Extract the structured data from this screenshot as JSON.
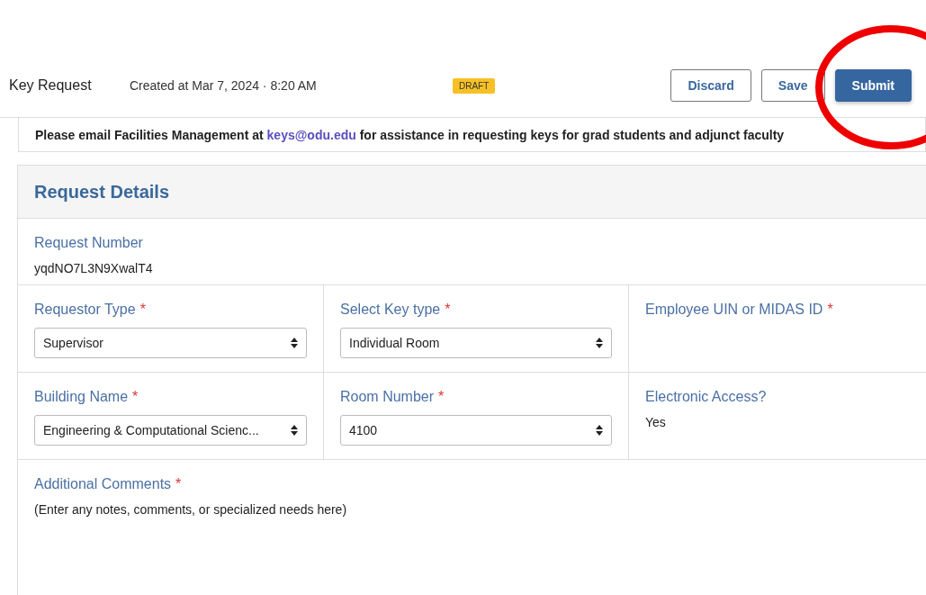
{
  "header": {
    "title": "Key Request",
    "created": "Created at Mar 7, 2024 · 8:20 AM",
    "status_badge": "DRAFT",
    "buttons": [
      {
        "label": "Discard",
        "kind": "outline"
      },
      {
        "label": "Save",
        "kind": "outline"
      },
      {
        "label": "Submit",
        "kind": "primary"
      }
    ]
  },
  "notice": {
    "before": "Please email Facilities Management at ",
    "link": "keys@odu.edu",
    "after": " for assistance in requesting keys for grad students and adjunct faculty"
  },
  "section": {
    "title": "Request Details",
    "request_number": {
      "label": "Request Number",
      "value": "yqdNO7L3N9XwalT4"
    },
    "rows": [
      [
        {
          "kind": "select",
          "label": "Requestor Type",
          "required_mark": "*",
          "value": "Supervisor"
        },
        {
          "kind": "select",
          "label": "Select Key type",
          "required_mark": "*",
          "value": "Individual Room"
        },
        {
          "kind": "empty",
          "label": "Employee UIN or MIDAS ID",
          "required_mark": "*"
        }
      ],
      [
        {
          "kind": "select",
          "label": "Building Name",
          "required_mark": "*",
          "value": "Engineering & Computational Scienc..."
        },
        {
          "kind": "select",
          "label": "Room Number",
          "required_mark": "*",
          "value": "4100"
        },
        {
          "kind": "text",
          "label": "Electronic Access?",
          "value": "Yes"
        }
      ]
    ],
    "comments": {
      "label": "Additional Comments",
      "required_mark": "*",
      "placeholder": "(Enter any notes, comments, or specialized needs here)"
    }
  },
  "annotation": {
    "kind": "circle"
  }
}
